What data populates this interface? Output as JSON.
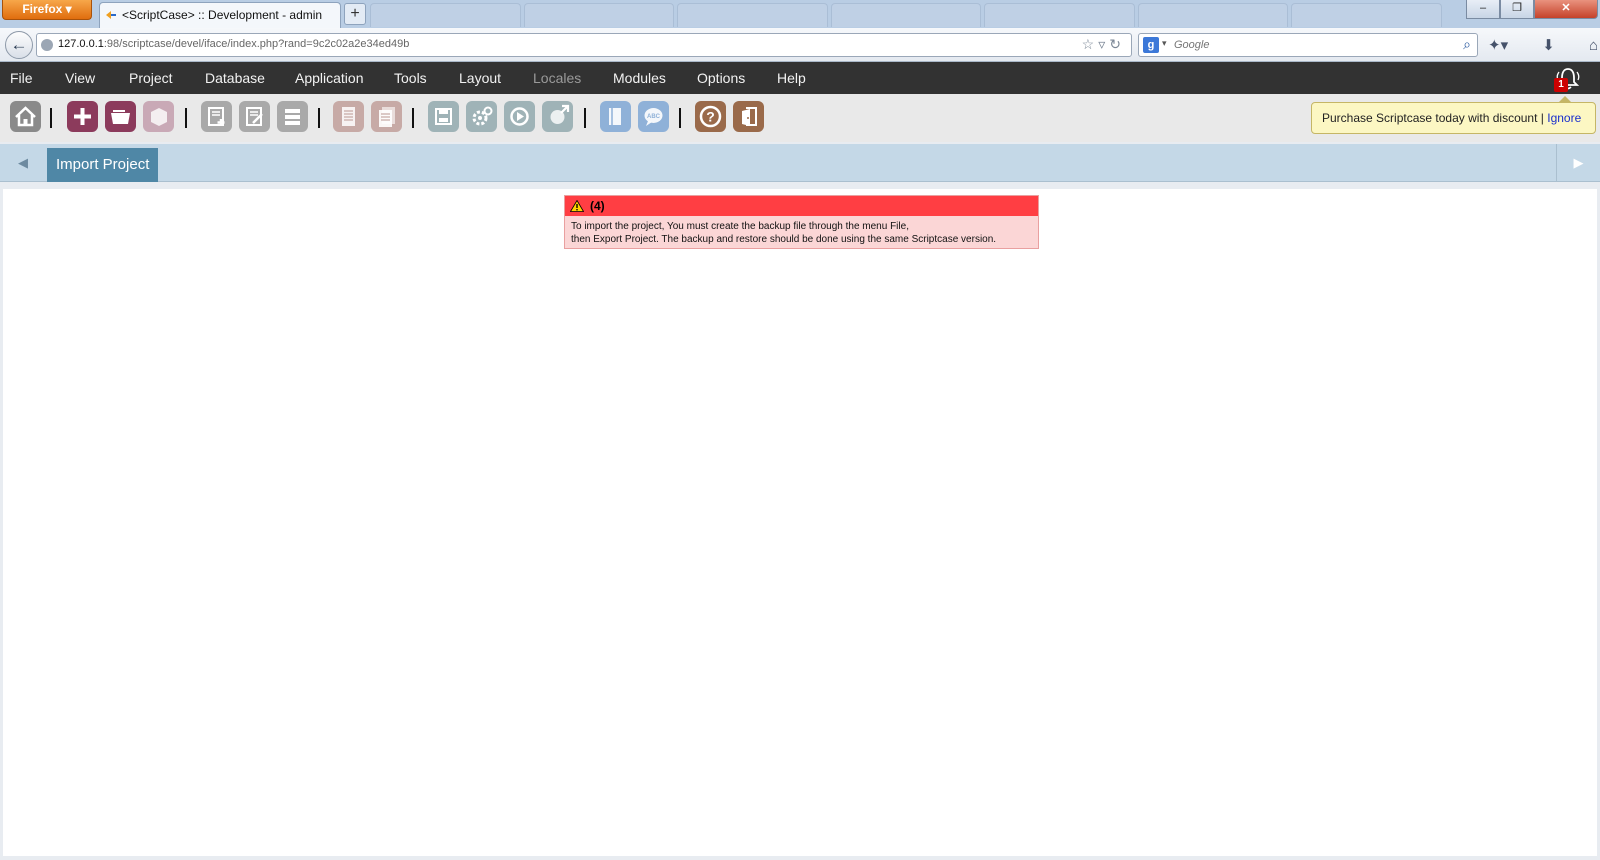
{
  "browser": {
    "firefox_label": "Firefox",
    "active_tab_title": "<ScriptCase> :: Development - admin",
    "url_host": "127.0.0.1",
    "url_path": ":98/scriptcase/devel/iface/index.php?rand=9c2c02a2e34ed49b",
    "search_placeholder": "Google",
    "search_engine_icon": "google-icon"
  },
  "menu": {
    "items": [
      "File",
      "View",
      "Project",
      "Database",
      "Application",
      "Tools",
      "Layout",
      "Locales",
      "Modules",
      "Options",
      "Help"
    ],
    "disabled": [
      "Locales"
    ],
    "notification_count": "1"
  },
  "toolbar": {
    "buttons": [
      {
        "icon": "home-icon",
        "active": true,
        "color": "#8a8a8a"
      },
      {
        "icon": "new-project-icon",
        "active": true,
        "color": "#8c3b5c"
      },
      {
        "icon": "open-project-icon",
        "active": true,
        "color": "#8c3b5c"
      },
      {
        "icon": "project-box-icon",
        "active": false,
        "color": "#c9a9b6"
      },
      {
        "icon": "new-application-icon",
        "active": false,
        "color": "#a9a9a9"
      },
      {
        "icon": "edit-application-icon",
        "active": false,
        "color": "#a9a9a9"
      },
      {
        "icon": "application-list-icon",
        "active": false,
        "color": "#a9a9a9"
      },
      {
        "icon": "document-icon",
        "active": false,
        "color": "#c7aaa6"
      },
      {
        "icon": "documents-icon",
        "active": false,
        "color": "#c7aaa6"
      },
      {
        "icon": "save-icon",
        "active": false,
        "color": "#9fb3b7"
      },
      {
        "icon": "generate-gear-icon",
        "active": false,
        "color": "#9fb3b7"
      },
      {
        "icon": "run-play-icon",
        "active": false,
        "color": "#9fb3b7"
      },
      {
        "icon": "export-icon",
        "active": false,
        "color": "#9fb3b7"
      },
      {
        "icon": "book-icon",
        "active": false,
        "color": "#8fb1d8"
      },
      {
        "icon": "chat-abc-icon",
        "active": false,
        "color": "#8fb1d8"
      },
      {
        "icon": "help-icon",
        "active": true,
        "color": "#9a6a4a"
      },
      {
        "icon": "exit-icon",
        "active": true,
        "color": "#9a6a4a"
      }
    ],
    "promo_text": "Purchase Scriptcase today with discount |",
    "promo_ignore": "Ignore"
  },
  "tabs": {
    "active_label": "Import Project"
  },
  "alert": {
    "code": "(4)",
    "line1": "To import the project, You must create the backup file through the menu File,",
    "line2": "then Export Project. The backup and restore should be done using the same Scriptcase version.",
    "header_color": "#ff3e43",
    "body_color": "#fbd6d6"
  }
}
